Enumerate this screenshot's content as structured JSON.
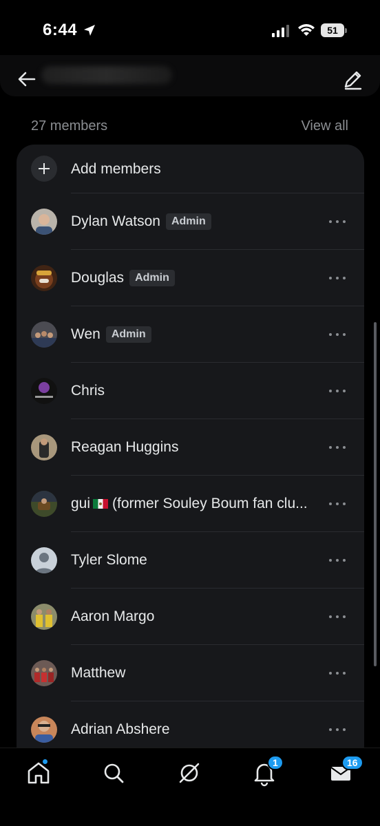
{
  "status_bar": {
    "time": "6:44",
    "battery": "51"
  },
  "header": {
    "back_icon": "arrow-left-icon",
    "edit_icon": "pencil-icon"
  },
  "summary": {
    "member_count": "27 members",
    "view_all": "View all"
  },
  "add_members": {
    "label": "Add members",
    "icon": "plus-icon"
  },
  "members": [
    {
      "name": "Dylan Watson",
      "admin": "Admin",
      "avatar_color": "#8a7a6a"
    },
    {
      "name": "Douglas",
      "admin": "Admin",
      "avatar_color": "#6b3a1e"
    },
    {
      "name": "Wen",
      "admin": "Admin",
      "avatar_color": "#5d5d64"
    },
    {
      "name": "Chris",
      "admin": "",
      "avatar_color": "#2b2433"
    },
    {
      "name": "Reagan Huggins",
      "admin": "",
      "avatar_color": "#8c7d66"
    },
    {
      "name_prefix": "gui",
      "name_suffix": "(former Souley Boum fan clu...",
      "admin": "",
      "avatar_color": "#4b4a2d"
    },
    {
      "name": "Tyler Slome",
      "admin": "",
      "avatar_color": "#c9d1d9"
    },
    {
      "name": "Aaron Margo",
      "admin": "",
      "avatar_color": "#7b6d3b"
    },
    {
      "name": "Matthew",
      "admin": "",
      "avatar_color": "#6a4a46"
    },
    {
      "name": "Adrian Abshere",
      "admin": "",
      "avatar_color": "#8a6b5b"
    }
  ],
  "bottom_nav": {
    "items": [
      "home-icon",
      "search-icon",
      "grok-icon",
      "notifications-icon",
      "messages-icon"
    ],
    "notifications_badge": "1",
    "messages_badge": "16"
  },
  "colors": {
    "accent": "#1d9bf0",
    "card": "#17181b",
    "muted_text": "#8b8e92"
  }
}
